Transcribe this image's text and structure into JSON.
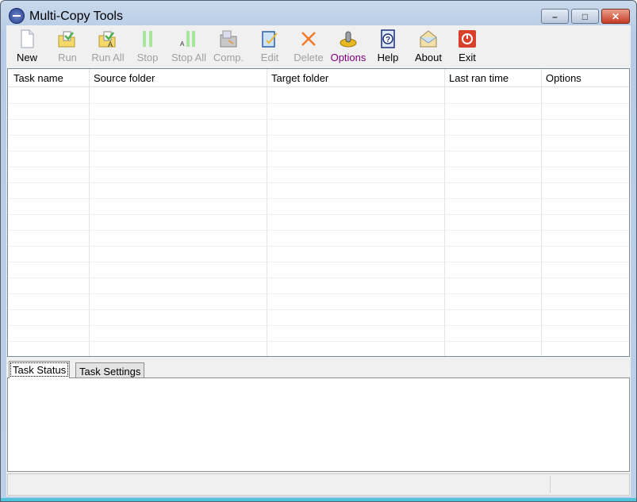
{
  "window": {
    "title": "Multi-Copy Tools",
    "minimize": "–",
    "maximize": "□",
    "close": "✕"
  },
  "toolbar": [
    {
      "label": "New",
      "icon": "new-document-icon",
      "enabled": true
    },
    {
      "label": "Run",
      "icon": "run-icon",
      "enabled": false
    },
    {
      "label": "Run All",
      "icon": "run-all-icon",
      "enabled": false
    },
    {
      "label": "Stop",
      "icon": "stop-icon",
      "enabled": false
    },
    {
      "label": "Stop All",
      "icon": "stop-all-icon",
      "enabled": false
    },
    {
      "label": "Comp.",
      "icon": "compare-icon",
      "enabled": false
    },
    {
      "label": "Edit",
      "icon": "edit-icon",
      "enabled": false
    },
    {
      "label": "Delete",
      "icon": "delete-icon",
      "enabled": false
    },
    {
      "label": "Options",
      "icon": "options-icon",
      "enabled": true
    },
    {
      "label": "Help",
      "icon": "help-icon",
      "enabled": true
    },
    {
      "label": "About",
      "icon": "about-icon",
      "enabled": true
    },
    {
      "label": "Exit",
      "icon": "exit-icon",
      "enabled": true
    }
  ],
  "table": {
    "columns": [
      "Task name",
      "Source folder",
      "Target folder",
      "Last ran time",
      "Options"
    ],
    "rows": []
  },
  "tabs": [
    {
      "label": "Task Status",
      "active": true
    },
    {
      "label": "Task Settings",
      "active": false
    }
  ],
  "colors": {
    "options_label": "#800080",
    "exit_red": "#d9402c"
  }
}
